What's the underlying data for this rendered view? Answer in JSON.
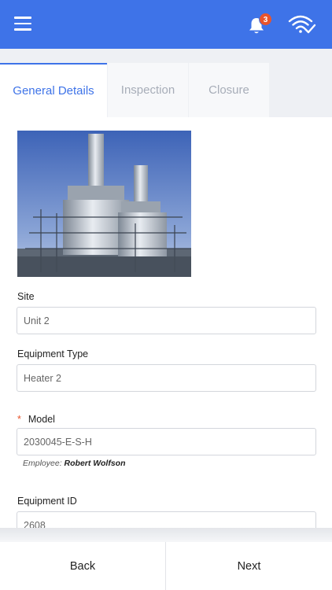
{
  "header": {
    "menu_icon": "hamburger-menu-icon",
    "notification_icon": "bell-icon",
    "notification_count": "3",
    "connection_icon": "wifi-check-icon",
    "accent_color": "#3e73e8",
    "badge_color": "#e8542c"
  },
  "tabs": [
    {
      "label": "General Details",
      "active": true
    },
    {
      "label": "Inspection",
      "active": false
    },
    {
      "label": "Closure",
      "active": false
    }
  ],
  "form": {
    "image": "industrial-plant-photo",
    "site": {
      "label": "Site",
      "value": "Unit 2"
    },
    "equipment_type": {
      "label": "Equipment Type",
      "value": "Heater 2"
    },
    "model": {
      "required_marker": "*",
      "label": "Model",
      "value": "2030045-E-S-H"
    },
    "employee": {
      "prefix": "Employee:",
      "name": "Robert Wolfson"
    },
    "equipment_id": {
      "label": "Equipment ID",
      "value": "2608"
    }
  },
  "footer": {
    "back_label": "Back",
    "next_label": "Next"
  }
}
